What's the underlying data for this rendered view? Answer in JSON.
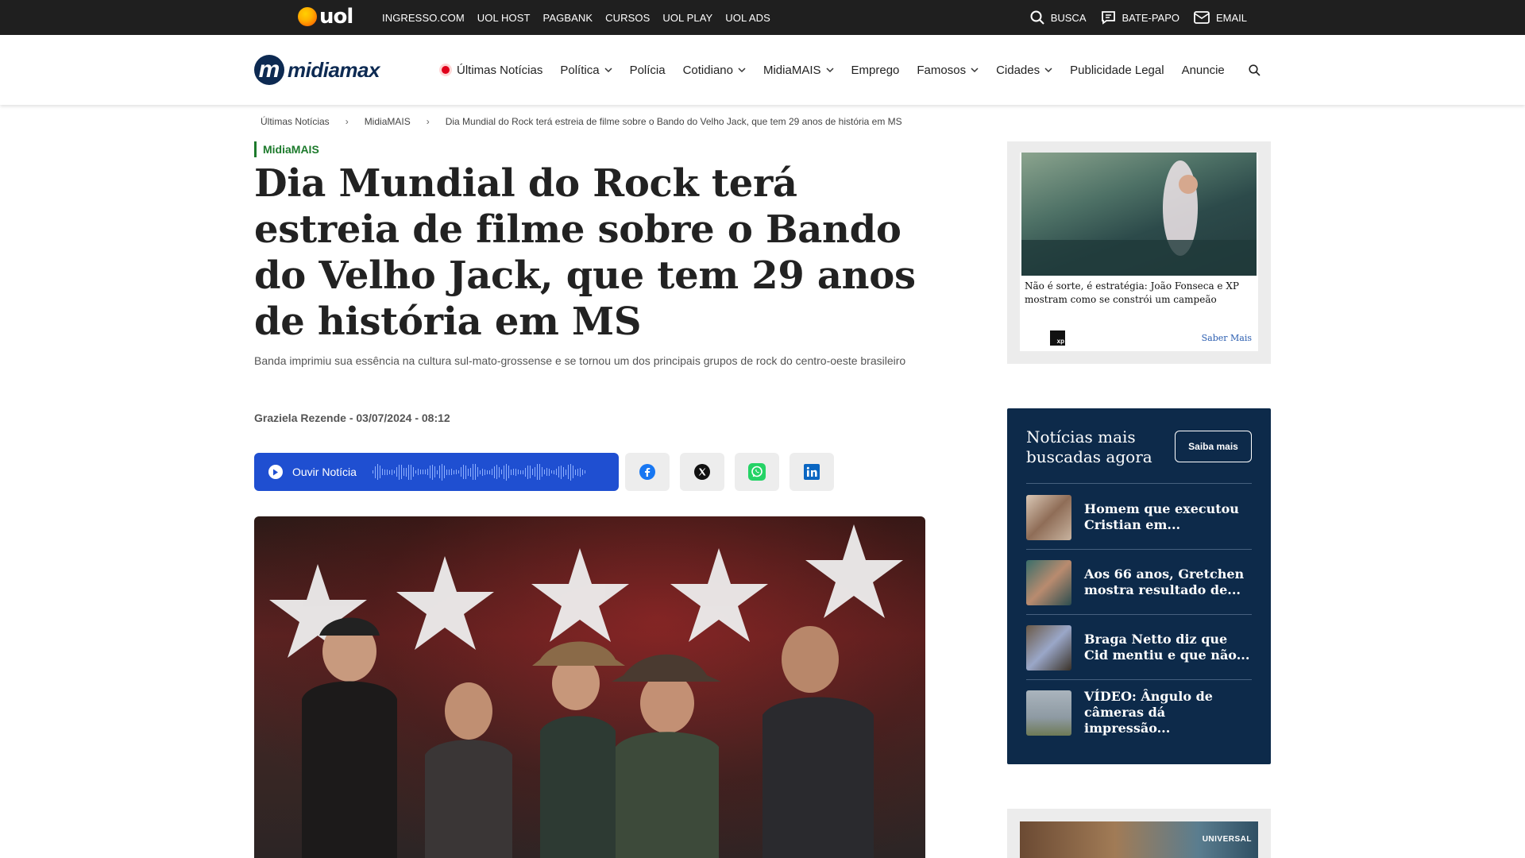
{
  "uol_bar": {
    "logo": "uol",
    "links": [
      "INGRESSO.COM",
      "UOL HOST",
      "PAGBANK",
      "CURSOS",
      "UOL PLAY",
      "UOL ADS"
    ],
    "search_label": "BUSCA",
    "chat_label": "BATE-PAPO",
    "email_label": "EMAIL"
  },
  "header": {
    "brand": "midiamax",
    "brand_mark": "m",
    "nav": [
      {
        "label": "Últimas Notícias",
        "icon": "live-dot-icon"
      },
      {
        "label": "Política",
        "dropdown": true
      },
      {
        "label": "Polícia"
      },
      {
        "label": "Cotidiano",
        "dropdown": true
      },
      {
        "label": "MidiaMAIS",
        "dropdown": true
      },
      {
        "label": "Emprego"
      },
      {
        "label": "Famosos",
        "dropdown": true
      },
      {
        "label": "Cidades",
        "dropdown": true
      },
      {
        "label": "Publicidade Legal"
      },
      {
        "label": "Anuncie"
      }
    ]
  },
  "breadcrumb": [
    "Últimas Notícias",
    "MidiaMAIS",
    "Dia Mundial do Rock terá estreia de filme sobre o Bando do Velho Jack, que tem 29 anos de história em MS"
  ],
  "article": {
    "section": "MidiaMAIS",
    "title": "Dia Mundial do Rock terá estreia de filme sobre o Bando do Velho Jack, que tem 29 anos de história em MS",
    "subtitle": "Banda imprimiu sua essência na cultura sul-mato-grossense e se tornou um dos principais grupos de rock do centro-oeste brasileiro",
    "byline": "Graziela Rezende - 03/07/2024 - 08:12",
    "listen_label": "Ouvir Notícia"
  },
  "ad": {
    "caption": "Não é sorte, é estratégia: João Fonseca e XP mostram como se constrói um campeão",
    "brand": "xp",
    "cta": "Saber Mais"
  },
  "trending": {
    "title": "Notícias mais buscadas agora",
    "button": "Saiba mais",
    "items": [
      {
        "text": "Homem que executou Cristian em..."
      },
      {
        "text": "Aos 66 anos, Gretchen mostra resultado de..."
      },
      {
        "text": "Braga Netto diz que Cid mentiu e que não..."
      },
      {
        "text": "VÍDEO: Ângulo de câmeras dá impressão..."
      }
    ]
  },
  "ad2": {
    "brand": "UNIVERSAL"
  },
  "colors": {
    "uol_bar": "#1f1f1f",
    "brand_navy": "#0d2a52",
    "section_green": "#1d7a2c",
    "listen_blue": "#1f4fd1",
    "trending_bg": "#0d2a4a",
    "live_red": "#e0001b"
  }
}
